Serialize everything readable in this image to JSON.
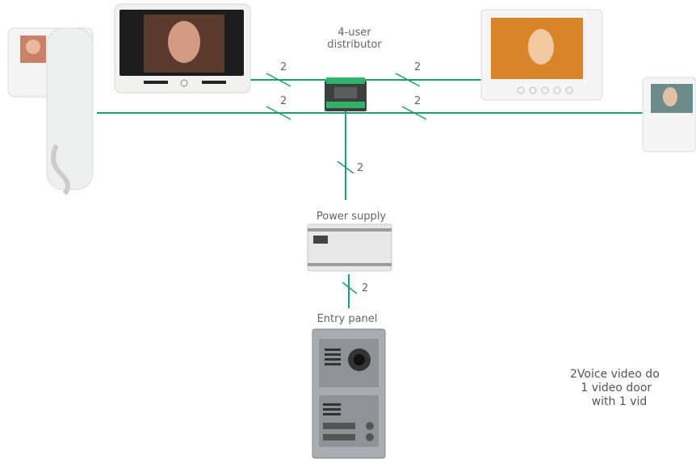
{
  "labels": {
    "distributor": "4-user\ndistributor",
    "power_supply": "Power supply",
    "entry_panel": "Entry panel"
  },
  "wire_count": "2",
  "caption": "2Voice video do\n   1 video door\n      with 1 vid",
  "colors": {
    "wire": "#1fa06b",
    "device_white": "#f4f5f4",
    "panel_gray": "#a9adb0"
  }
}
